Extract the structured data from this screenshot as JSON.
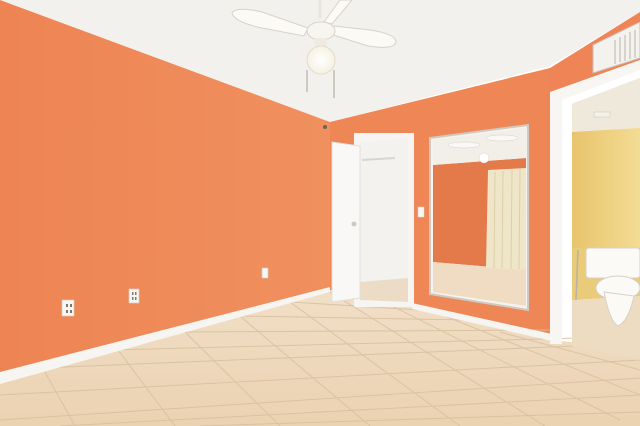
{
  "scene": {
    "description_type": "photo",
    "colors": {
      "wall_left": "#f0895a",
      "wall_back": "#ef8655",
      "ceiling": "#f4f2ee",
      "floor": "#efd9bd",
      "trim": "#f7f5f1",
      "bath_wall": "#f1d98a"
    }
  }
}
